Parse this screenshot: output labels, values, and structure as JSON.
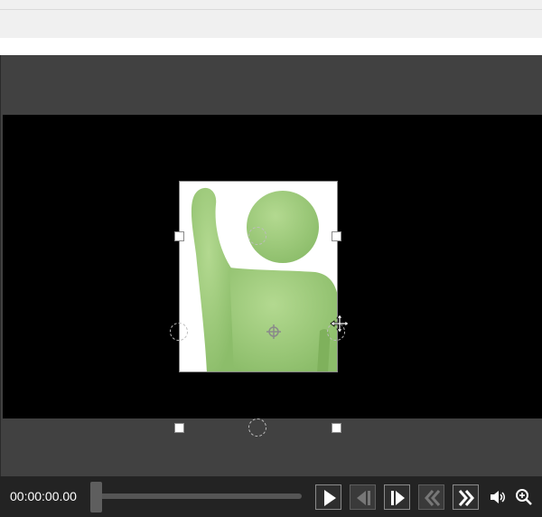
{
  "player": {
    "time_display": "00:00:00.00",
    "seek_position_fraction": 0.0
  },
  "icons": {
    "play": "play-icon",
    "prev_frame": "previous-frame-icon",
    "next_frame": "next-frame-icon",
    "rewind": "rewind-icon",
    "fast_forward": "fast-forward-icon",
    "volume": "volume-icon",
    "zoom": "zoom-in-icon",
    "move_cursor": "move-cursor-icon"
  },
  "colors": {
    "figure_green": "#9cc97a",
    "controls_bg": "#232323",
    "frame_bg": "#414141"
  }
}
